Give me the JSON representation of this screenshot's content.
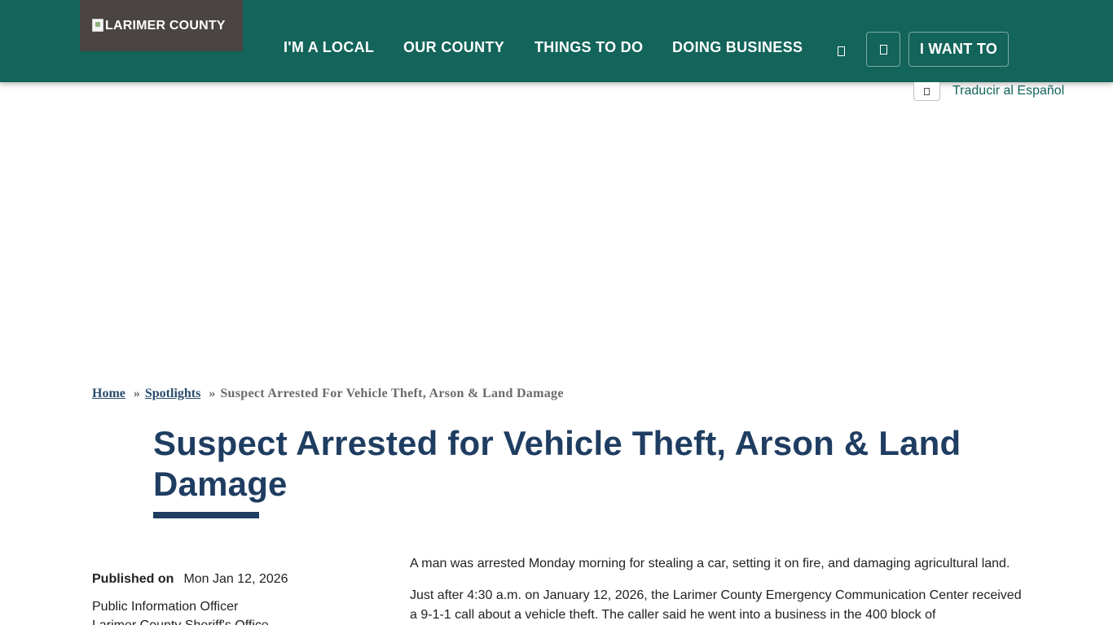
{
  "header": {
    "logo_alt": "LARIMER COUNTY",
    "nav": [
      {
        "label": "I'M A LOCAL"
      },
      {
        "label": "OUR COUNTY"
      },
      {
        "label": "THINGS TO DO"
      },
      {
        "label": "DOING BUSINESS"
      }
    ],
    "i_want_to": "I WANT TO"
  },
  "translate": {
    "label": "Traducir al Español"
  },
  "breadcrumb": {
    "home": "Home",
    "separator": "»",
    "spotlights": "Spotlights",
    "current": "Suspect Arrested For Vehicle Theft, Arson & Land Damage"
  },
  "article": {
    "title": "Suspect Arrested for Vehicle Theft, Arson & Land Damage",
    "published_label": "Published on",
    "published_date": "Mon Jan 12, 2026",
    "author_line1": "Public Information Officer",
    "author_line2": "Larimer County Sheriff's Office",
    "paragraphs": [
      "A man was arrested Monday morning for stealing a car, setting it on fire, and damaging agricultural land.",
      "Just after 4:30 a.m. on January 12, 2026, the Larimer County Emergency Communication Center received a 9-1-1 call about a vehicle theft. The caller said he went into a business in the 400 block of"
    ]
  },
  "colors": {
    "header": "#13645a",
    "logo_bg": "#4a4442",
    "title": "#1f3d61",
    "link": "#2a4d6e"
  },
  "icons": [
    "broken-image-icon",
    "chevron-glyph-icon",
    "search-icon",
    "translate-toggle-icon"
  ]
}
